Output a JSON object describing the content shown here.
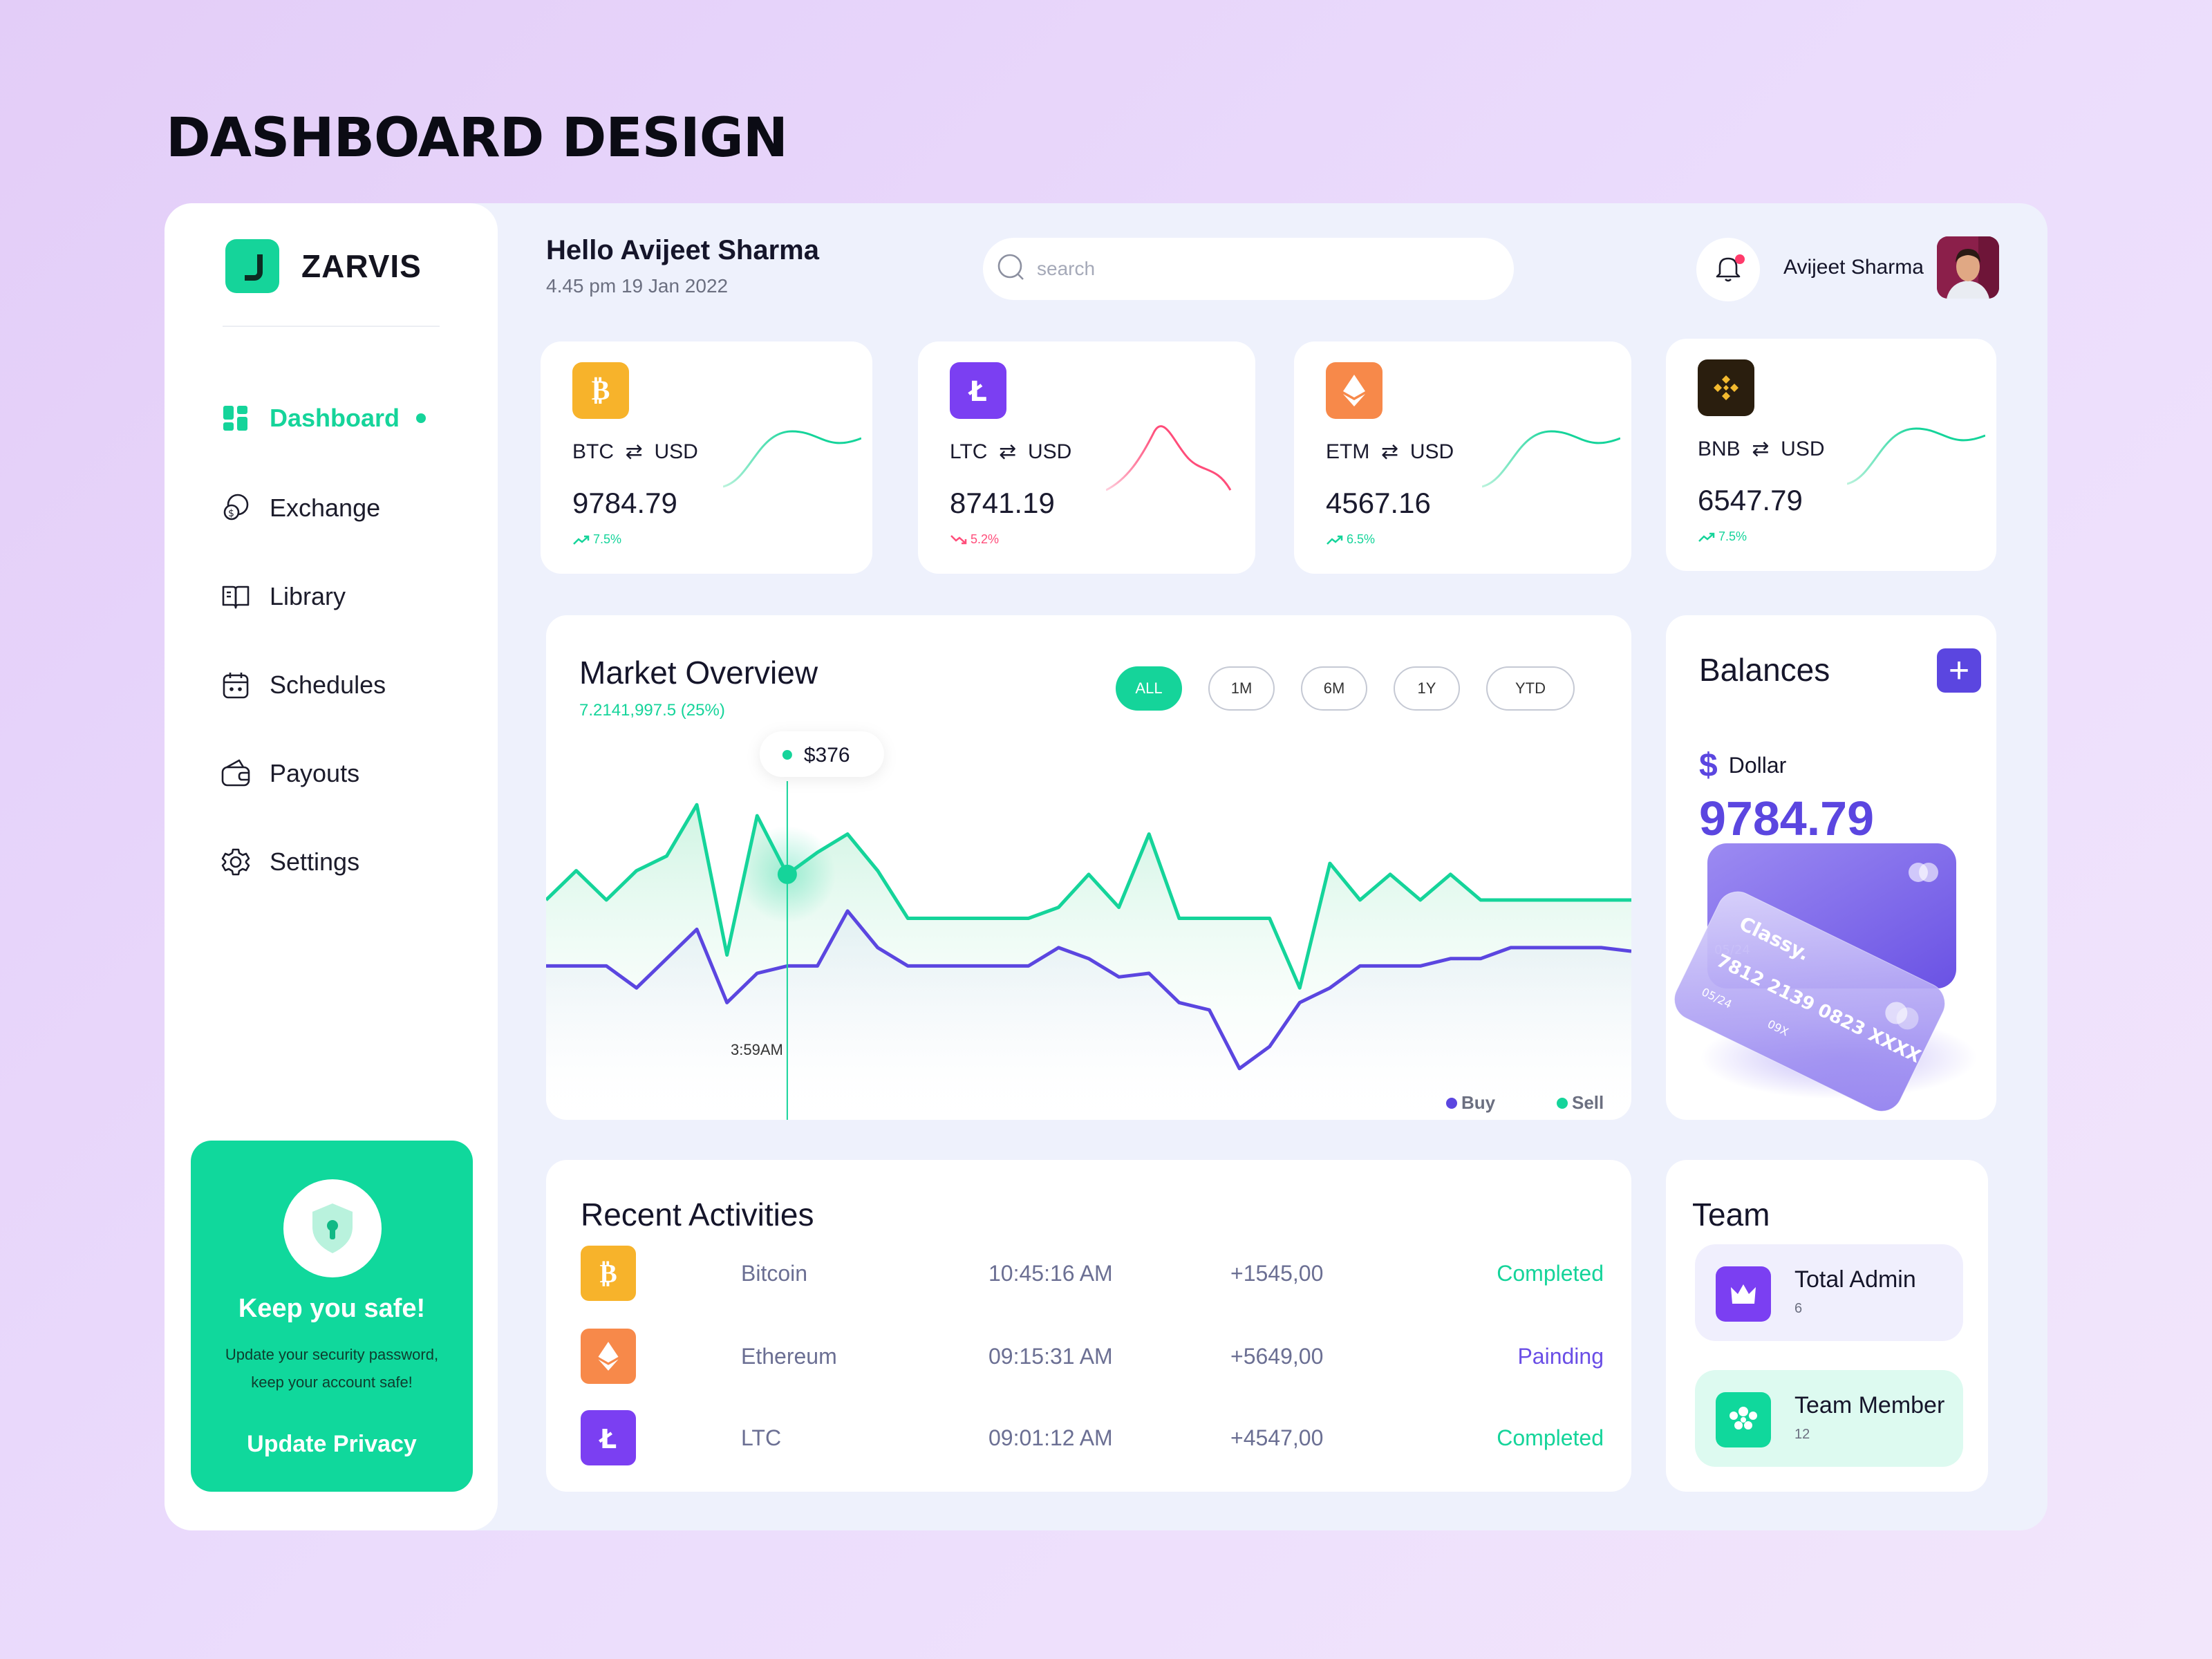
{
  "page_title": "DASHBOARD DESIGN",
  "brand": {
    "name": "ZARVIS"
  },
  "nav": [
    {
      "label": "Dashboard",
      "icon": "dashboard-icon",
      "active": true
    },
    {
      "label": "Exchange",
      "icon": "exchange-icon"
    },
    {
      "label": "Library",
      "icon": "book-icon"
    },
    {
      "label": "Schedules",
      "icon": "calendar-icon"
    },
    {
      "label": "Payouts",
      "icon": "wallet-icon"
    },
    {
      "label": "Settings",
      "icon": "gear-icon"
    }
  ],
  "security_card": {
    "title": "Keep you safe!",
    "text": "Update your security password, keep your account safe!",
    "link": "Update Privacy"
  },
  "header": {
    "greeting": "Hello Avijeet Sharma",
    "datetime": "4.45 pm 19 Jan 2022",
    "search_placeholder": "search",
    "user_name": "Avijeet Sharma"
  },
  "coins": [
    {
      "symbol": "BTC",
      "quote": "USD",
      "price": "9784.79",
      "change": "7.5%",
      "trend": "up",
      "color": "#f7b32b",
      "icon": "bitcoin-icon"
    },
    {
      "symbol": "LTC",
      "quote": "USD",
      "price": "8741.19",
      "change": "5.2%",
      "trend": "down",
      "color": "#7b3ff2",
      "icon": "litecoin-icon"
    },
    {
      "symbol": "ETM",
      "quote": "USD",
      "price": "4567.16",
      "change": "6.5%",
      "trend": "up",
      "color": "#f7894a",
      "icon": "ethereum-icon"
    },
    {
      "symbol": "BNB",
      "quote": "USD",
      "price": "6547.79",
      "change": "7.5%",
      "trend": "up",
      "color": "#2a1e0e",
      "icon": "binance-icon"
    }
  ],
  "market": {
    "title": "Market Overview",
    "subtitle": "7.2141,997.5 (25%)",
    "ranges": [
      "ALL",
      "1M",
      "6M",
      "1Y",
      "YTD"
    ],
    "active_range": "ALL",
    "tooltip_value": "$376",
    "tooltip_time": "3:59AM"
  },
  "chart_data": {
    "type": "line",
    "series": [
      {
        "name": "Sell",
        "color": "#15d49a",
        "values": [
          60,
          68,
          60,
          68,
          72,
          86,
          45,
          83,
          67,
          73,
          78,
          68,
          55,
          55,
          55,
          55,
          55,
          58,
          67,
          58,
          78,
          55,
          55,
          55,
          55,
          36,
          70,
          60,
          67,
          60,
          67,
          60,
          60,
          60,
          60,
          60,
          60
        ]
      },
      {
        "name": "Buy",
        "color": "#5b46e0",
        "values": [
          42,
          42,
          42,
          36,
          44,
          52,
          32,
          40,
          42,
          42,
          57,
          47,
          42,
          42,
          42,
          42,
          42,
          47,
          44,
          39,
          40,
          32,
          30,
          14,
          20,
          32,
          36,
          42,
          42,
          42,
          44,
          44,
          47,
          47,
          47,
          47,
          46
        ]
      }
    ],
    "legend": [
      "Buy",
      "Sell"
    ]
  },
  "balances": {
    "title": "Balances",
    "currency_symbol": "$",
    "currency": "Dollar",
    "amount": "9784.79",
    "card": {
      "brand": "Classy.",
      "number": "7812 2139 0823 XXXX",
      "expiry": "05/24",
      "cvv": "09X"
    }
  },
  "activities": {
    "title": "Recent Activities",
    "rows": [
      {
        "name": "Bitcoin",
        "time": "10:45:16 AM",
        "amount": "+1545,00",
        "status": "Completed",
        "status_color": "#15d49a",
        "color": "#f7b32b",
        "icon": "bitcoin-icon"
      },
      {
        "name": "Ethereum",
        "time": "09:15:31 AM",
        "amount": "+5649,00",
        "status": "Painding",
        "status_color": "#6a4ee6",
        "color": "#f7894a",
        "icon": "ethereum-icon"
      },
      {
        "name": "LTC",
        "time": "09:01:12 AM",
        "amount": "+4547,00",
        "status": "Completed",
        "status_color": "#15d49a",
        "color": "#7b3ff2",
        "icon": "litecoin-icon"
      }
    ]
  },
  "team": {
    "title": "Team",
    "items": [
      {
        "label": "Total Admin",
        "count": "6",
        "bg": "#f0effd",
        "icon_bg": "#7b3ff2",
        "icon": "crown-icon"
      },
      {
        "label": "Team Member",
        "count": "12",
        "bg": "#ddfaf0",
        "icon_bg": "#10d89c",
        "icon": "group-icon"
      }
    ]
  }
}
